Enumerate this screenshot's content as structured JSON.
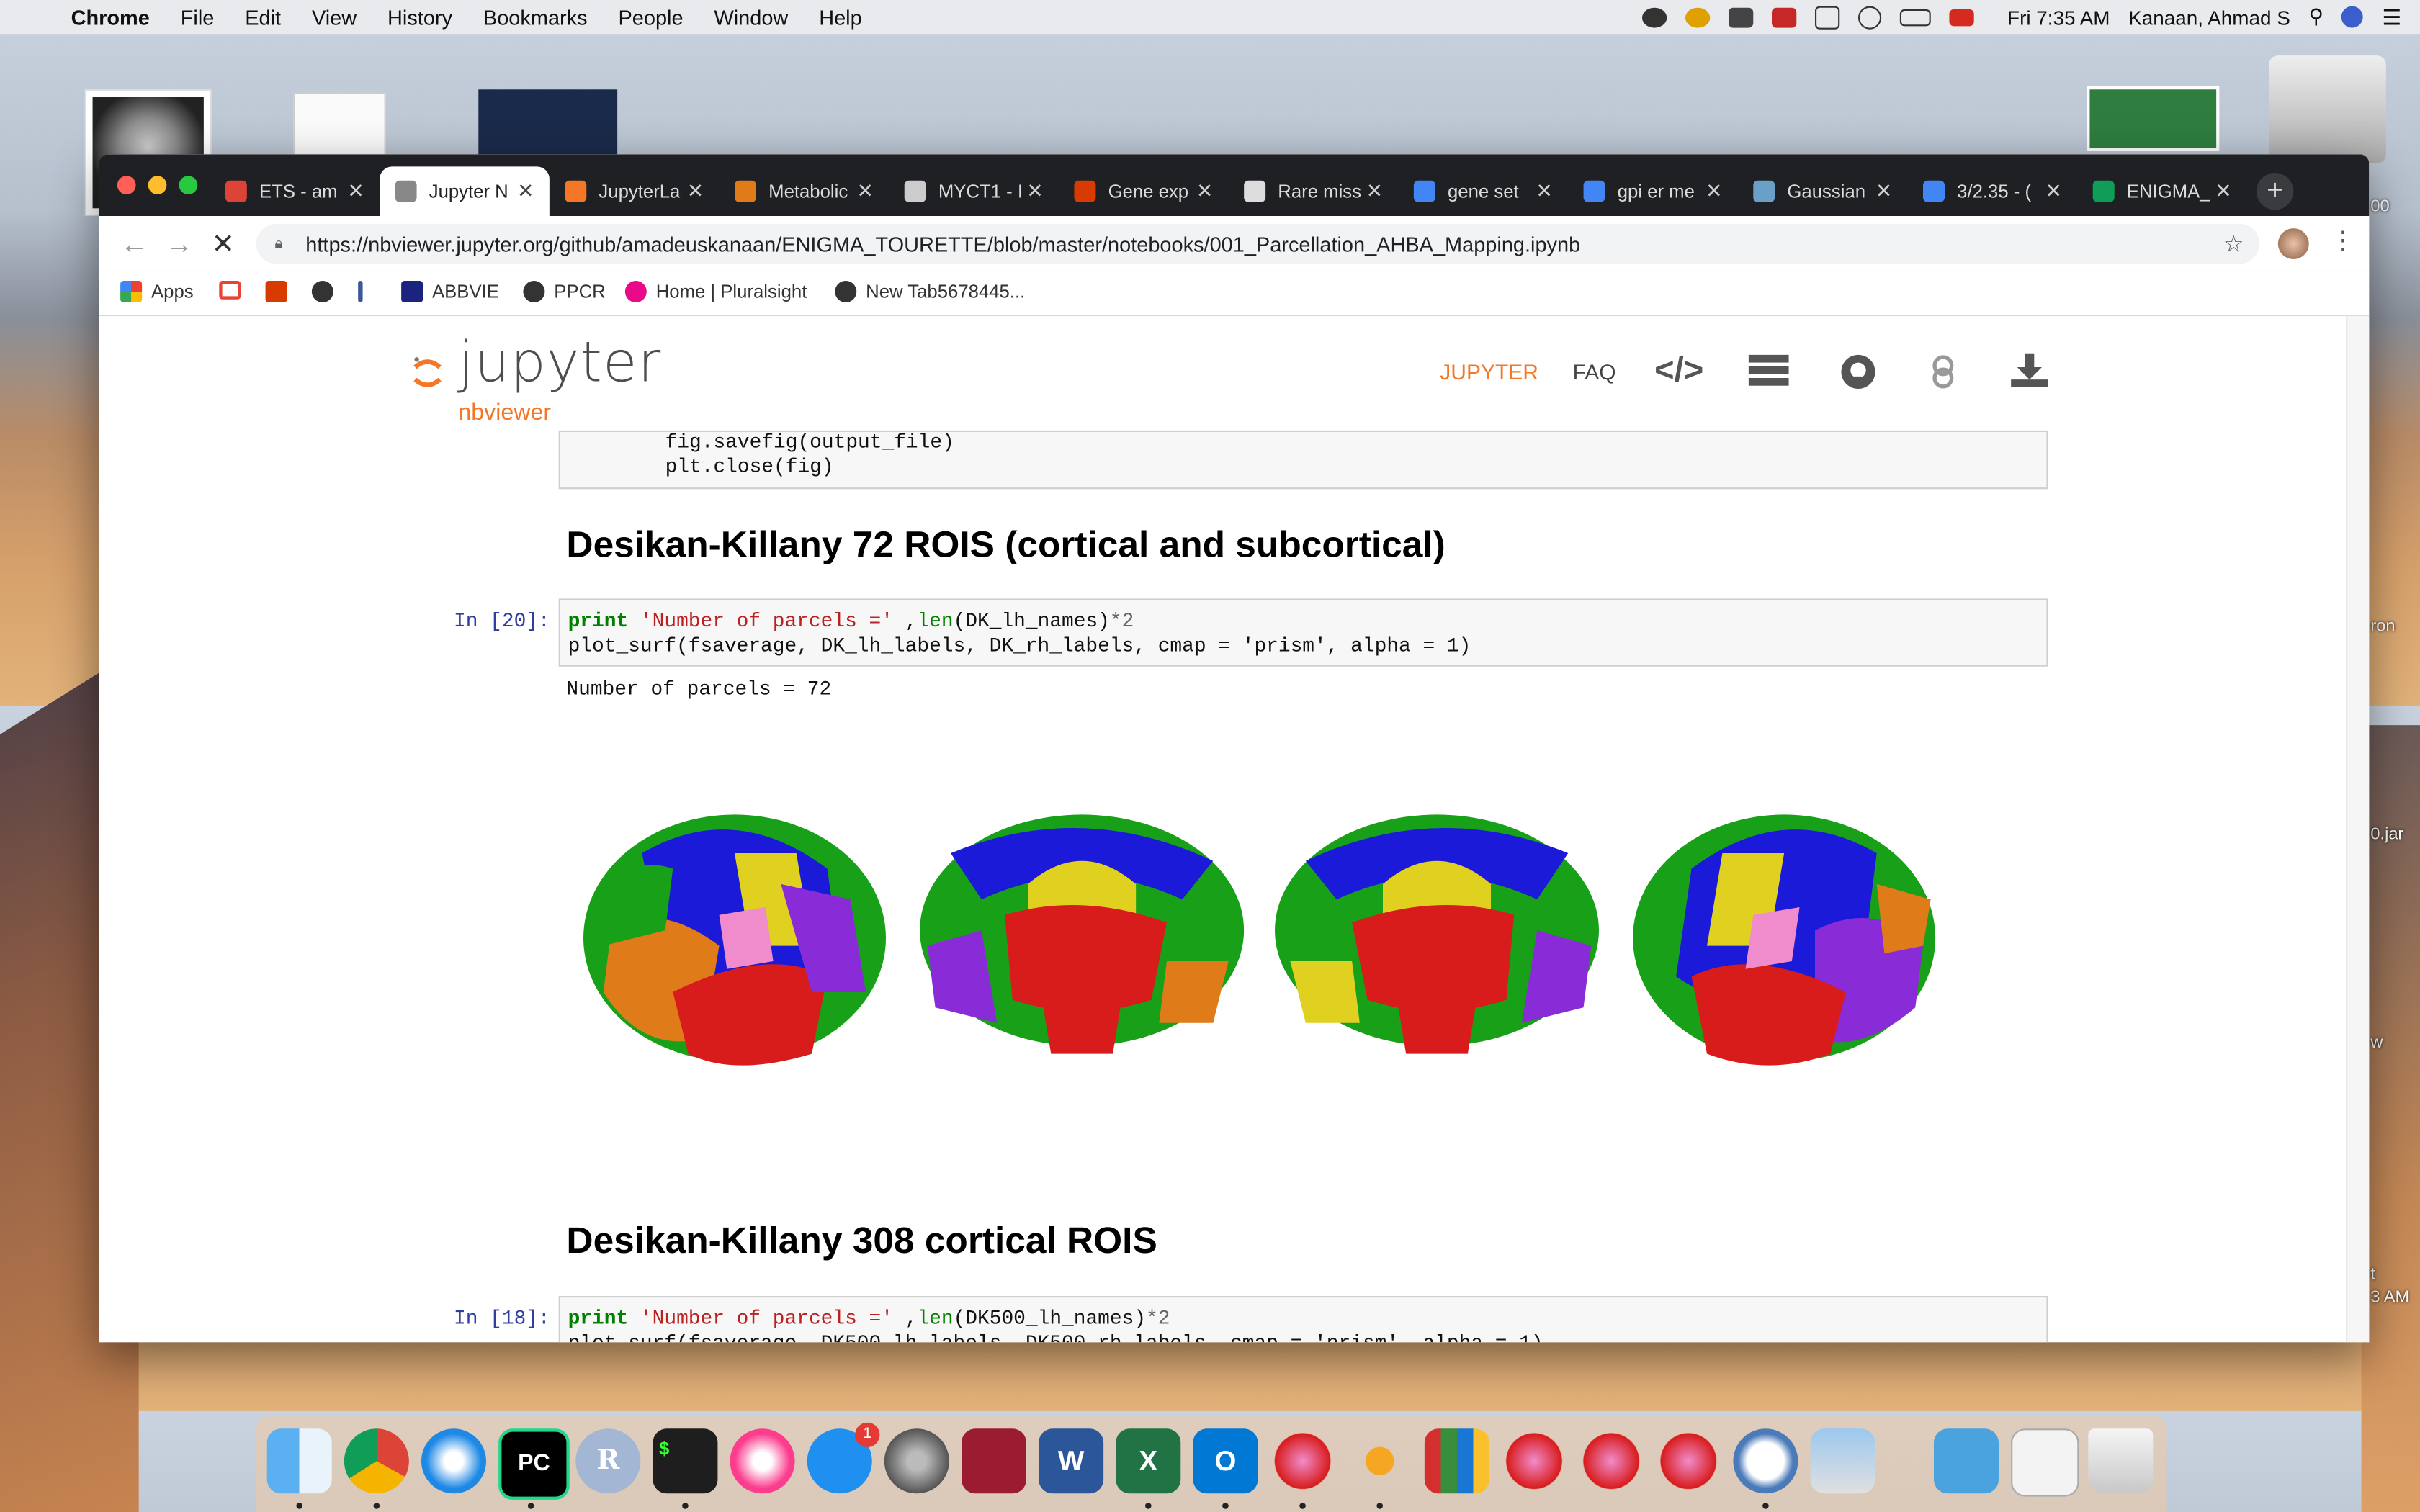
{
  "menubar": {
    "app": "Chrome",
    "items": [
      "File",
      "Edit",
      "View",
      "History",
      "Bookmarks",
      "People",
      "Window",
      "Help"
    ],
    "clock": "Fri 7:35 AM",
    "user": "Kanaan, Ahmad S"
  },
  "desktop": {
    "side_labels": [
      "00",
      "ron",
      "0.jar",
      "w",
      "t",
      "3 AM"
    ]
  },
  "tabs": [
    {
      "label": "ETS - am",
      "color": "#db4437"
    },
    {
      "label": "Jupyter N",
      "color": "#888888"
    },
    {
      "label": "JupyterLa",
      "color": "#f37726"
    },
    {
      "label": "Metabolic",
      "color": "#e07b1a"
    },
    {
      "label": "MYCT1 - I",
      "color": "#cccccc"
    },
    {
      "label": "Gene exp",
      "color": "#d83b01"
    },
    {
      "label": "Rare miss",
      "color": "#dddddd"
    },
    {
      "label": "gene set",
      "color": "#4285f4"
    },
    {
      "label": "gpi er me",
      "color": "#4285f4"
    },
    {
      "label": "Gaussian",
      "color": "#6aa0c8"
    },
    {
      "label": "3/2.35 - (",
      "color": "#4285f4"
    },
    {
      "label": "ENIGMA_",
      "color": "#0f9d58"
    }
  ],
  "active_tab_index": 1,
  "url": "https://nbviewer.jupyter.org/github/amadeuskanaan/ENIGMA_TOURETTE/blob/master/notebooks/001_Parcellation_AHBA_Mapping.ipynb",
  "bookmarks": [
    {
      "label": "Apps",
      "icon": "apps-grid-icon"
    },
    {
      "label": "",
      "icon": "gmail-icon"
    },
    {
      "label": "",
      "icon": "office-icon"
    },
    {
      "label": "",
      "icon": "globe-icon"
    },
    {
      "label": "",
      "icon": "facebook-icon"
    },
    {
      "label": "ABBVIE",
      "icon": "abbvie-icon"
    },
    {
      "label": "PPCR",
      "icon": "globe-icon"
    },
    {
      "label": "Home | Pluralsight",
      "icon": "pluralsight-icon"
    },
    {
      "label": "New Tab5678445...",
      "icon": "globe-icon"
    }
  ],
  "nbviewer": {
    "logo_word": "jupyter",
    "logo_sub": "nbviewer",
    "nav_jupyter": "JUPYTER",
    "nav_faq": "FAQ"
  },
  "prev_cell": {
    "line1": "fig.savefig(output_file)",
    "line2": "plt.close(fig)"
  },
  "section1": {
    "heading": "Desikan-Killany 72 ROIS (cortical and subcortical)",
    "prompt": "In [20]:",
    "code_line2": "plot_surf(fsaverage, DK_lh_labels, DK_rh_labels, cmap = 'prism', alpha = 1)",
    "output": "Number of parcels = 72"
  },
  "section2": {
    "heading": "Desikan-Killany 308 cortical ROIS",
    "prompt": "In [18]:",
    "code_line2": "plot_surf(fsaverage, DK500_lh_labels, DK500_rh_labels, cmap = 'prism', alpha = 1)"
  },
  "dock": {
    "badge_appstore": "1"
  }
}
